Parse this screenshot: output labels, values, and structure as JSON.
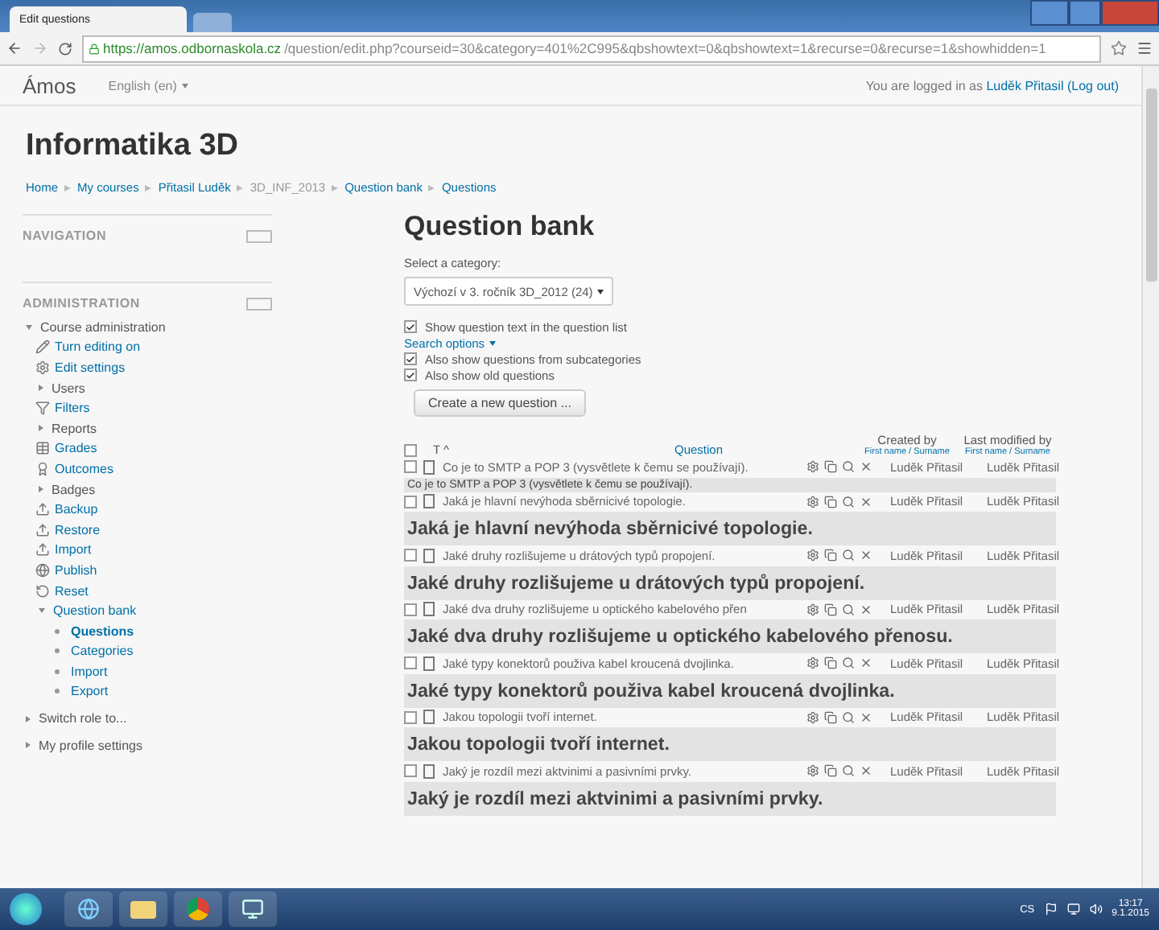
{
  "browser": {
    "tab_title": "Edit questions",
    "url_host": "https://amos.odbornaskola.cz",
    "url_path": "/question/edit.php?courseid=30&category=401%2C995&qbshowtext=0&qbshowtext=1&recurse=0&recurse=1&showhidden=1"
  },
  "navbar": {
    "brand": "Ámos",
    "language": "English (en)",
    "login_prefix": "You are logged in as",
    "user": "Luděk Přitasil",
    "logout": "(Log out)"
  },
  "course_title": "Informatika 3D",
  "breadcrumb": [
    "Home",
    "My courses",
    "Přitasil Luděk",
    "3D_INF_2013",
    "Question bank",
    "Questions"
  ],
  "blocks": [
    {
      "title": "NAVIGATION"
    },
    {
      "title": "ADMINISTRATION"
    }
  ],
  "admin_tree": [
    {
      "label": "Course administration",
      "kind": "branch",
      "expanded": true,
      "children": [
        {
          "label": "Turn editing on",
          "kind": "action"
        },
        {
          "label": "Edit settings",
          "kind": "action"
        },
        {
          "label": "Users",
          "kind": "branch",
          "expanded": false
        },
        {
          "label": "Filters",
          "kind": "action"
        },
        {
          "label": "Reports",
          "kind": "branch",
          "expanded": false
        },
        {
          "label": "Grades",
          "kind": "action"
        },
        {
          "label": "Outcomes",
          "kind": "action"
        },
        {
          "label": "Badges",
          "kind": "branch",
          "expanded": false
        },
        {
          "label": "Backup",
          "kind": "action"
        },
        {
          "label": "Restore",
          "kind": "action"
        },
        {
          "label": "Import",
          "kind": "action"
        },
        {
          "label": "Publish",
          "kind": "action"
        },
        {
          "label": "Reset",
          "kind": "action"
        },
        {
          "label": "Question bank",
          "kind": "branch",
          "expanded": true,
          "children": [
            {
              "label": "Questions",
              "kind": "bullet",
              "selected": true
            },
            {
              "label": "Categories",
              "kind": "bullet",
              "selected": false
            },
            {
              "label": "Import",
              "kind": "bullet",
              "selected": false
            },
            {
              "label": "Export",
              "kind": "bullet",
              "selected": false
            }
          ]
        }
      ]
    },
    {
      "label": "Switch role to...",
      "kind": "branch",
      "expanded": false
    },
    {
      "label": "My profile settings",
      "kind": "branch",
      "expanded": false
    }
  ],
  "page_title": "Question bank",
  "category": {
    "label": "Select a category:",
    "value": "Výchozí v 3. ročník 3D_2012 (24)"
  },
  "options": [
    {
      "label": "Show question text in the question list",
      "checked": true
    }
  ],
  "search_options": "Search options",
  "search_checks": [
    {
      "label": "Also show questions from subcategories",
      "checked": true
    },
    {
      "label": "Also show old questions",
      "checked": true
    }
  ],
  "create_button": "Create a new question ...",
  "table": {
    "type_header": "T",
    "sort_mark": "^",
    "question_header": "Question",
    "created_header": "Created by",
    "modified_header": "Last modified by",
    "created_sort": "First name / Surname",
    "modified_sort": "First name / Surname",
    "select_all_checked": false,
    "rows": [
      {
        "name": "Co je to SMTP a POP 3 (vysvětlete k čemu se používají).",
        "created": "Luděk Přitasil",
        "modified": "Luděk Přitasil",
        "checked": false,
        "preview": {
          "text": "Co je to SMTP a POP 3 (vysvětlete k čemu se používají).",
          "kind": "plain"
        }
      },
      {
        "name": "Jaká je hlavní nevýhoda sběrnicivé topologie.",
        "created": "Luděk Přitasil",
        "modified": "Luděk Přitasil",
        "checked": false,
        "preview": {
          "text": "Jaká je hlavní nevýhoda sběrnicivé topologie.",
          "kind": "heading"
        }
      },
      {
        "name": "Jaké druhy rozlišujeme u drátových typů propojení.",
        "created": "Luděk Přitasil",
        "modified": "Luděk Přitasil",
        "checked": false,
        "preview": {
          "text": "Jaké druhy rozlišujeme u drátových typů propojení.",
          "kind": "heading"
        }
      },
      {
        "name": "Jaké dva druhy rozlišujeme u optického kabelového přen",
        "created": "Luděk Přitasil",
        "modified": "Luděk Přitasil",
        "checked": false,
        "preview": {
          "text": "Jaké dva druhy rozlišujeme u optického kabelového přenosu.",
          "kind": "heading"
        }
      },
      {
        "name": "Jaké typy konektorů použiva kabel kroucená dvojlinka.",
        "created": "Luděk Přitasil",
        "modified": "Luděk Přitasil",
        "checked": false,
        "preview": {
          "text": "Jaké typy konektorů použiva kabel kroucená dvojlinka.",
          "kind": "heading"
        }
      },
      {
        "name": "Jakou topologii tvoří internet.",
        "created": "Luděk Přitasil",
        "modified": "Luděk Přitasil",
        "checked": false,
        "preview": {
          "text": "Jakou topologii tvoří internet.",
          "kind": "heading"
        }
      },
      {
        "name": "Jaký je rozdíl mezi aktvinimi a pasivními prvky.",
        "created": "Luděk Přitasil",
        "modified": "Luděk Přitasil",
        "checked": false,
        "preview": {
          "text": "Jaký je rozdíl mezi aktvinimi a pasivními prvky.",
          "kind": "heading"
        }
      }
    ]
  },
  "taskbar": {
    "language": "CS",
    "time": "13:17",
    "date": "9.1.2015"
  }
}
